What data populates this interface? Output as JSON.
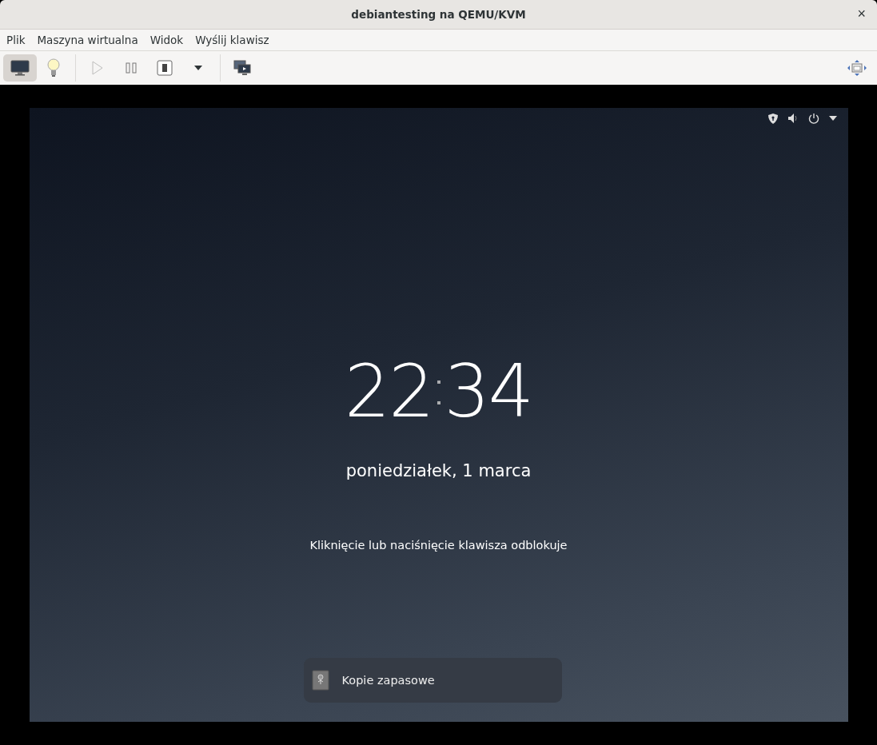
{
  "window": {
    "title": "debiantesting na QEMU/KVM",
    "close": "×"
  },
  "menu": [
    "Plik",
    "Maszyna wirtualna",
    "Widok",
    "Wyślij klawisz"
  ],
  "toolbar": [
    {
      "kind": "display",
      "selected": true,
      "disabled": false
    },
    {
      "kind": "bulb",
      "selected": false,
      "disabled": false
    },
    {
      "kind": "separator"
    },
    {
      "kind": "play",
      "selected": false,
      "disabled": true
    },
    {
      "kind": "pause",
      "selected": false,
      "disabled": false
    },
    {
      "kind": "power",
      "selected": false,
      "disabled": false
    },
    {
      "kind": "dropdown",
      "selected": false,
      "disabled": false
    },
    {
      "kind": "separator"
    },
    {
      "kind": "screens",
      "selected": false,
      "disabled": false
    },
    {
      "kind": "spacer"
    },
    {
      "kind": "fullscreen",
      "selected": false,
      "disabled": false
    }
  ],
  "lock_screen": {
    "time_hours": "22",
    "time_minutes": "34",
    "date": "poniedziałek, 1 marca",
    "hint": "Kliknięcie lub naciśnięcie klawisza odblokuje",
    "notification": {
      "title": "Kopie zapasowe"
    }
  }
}
